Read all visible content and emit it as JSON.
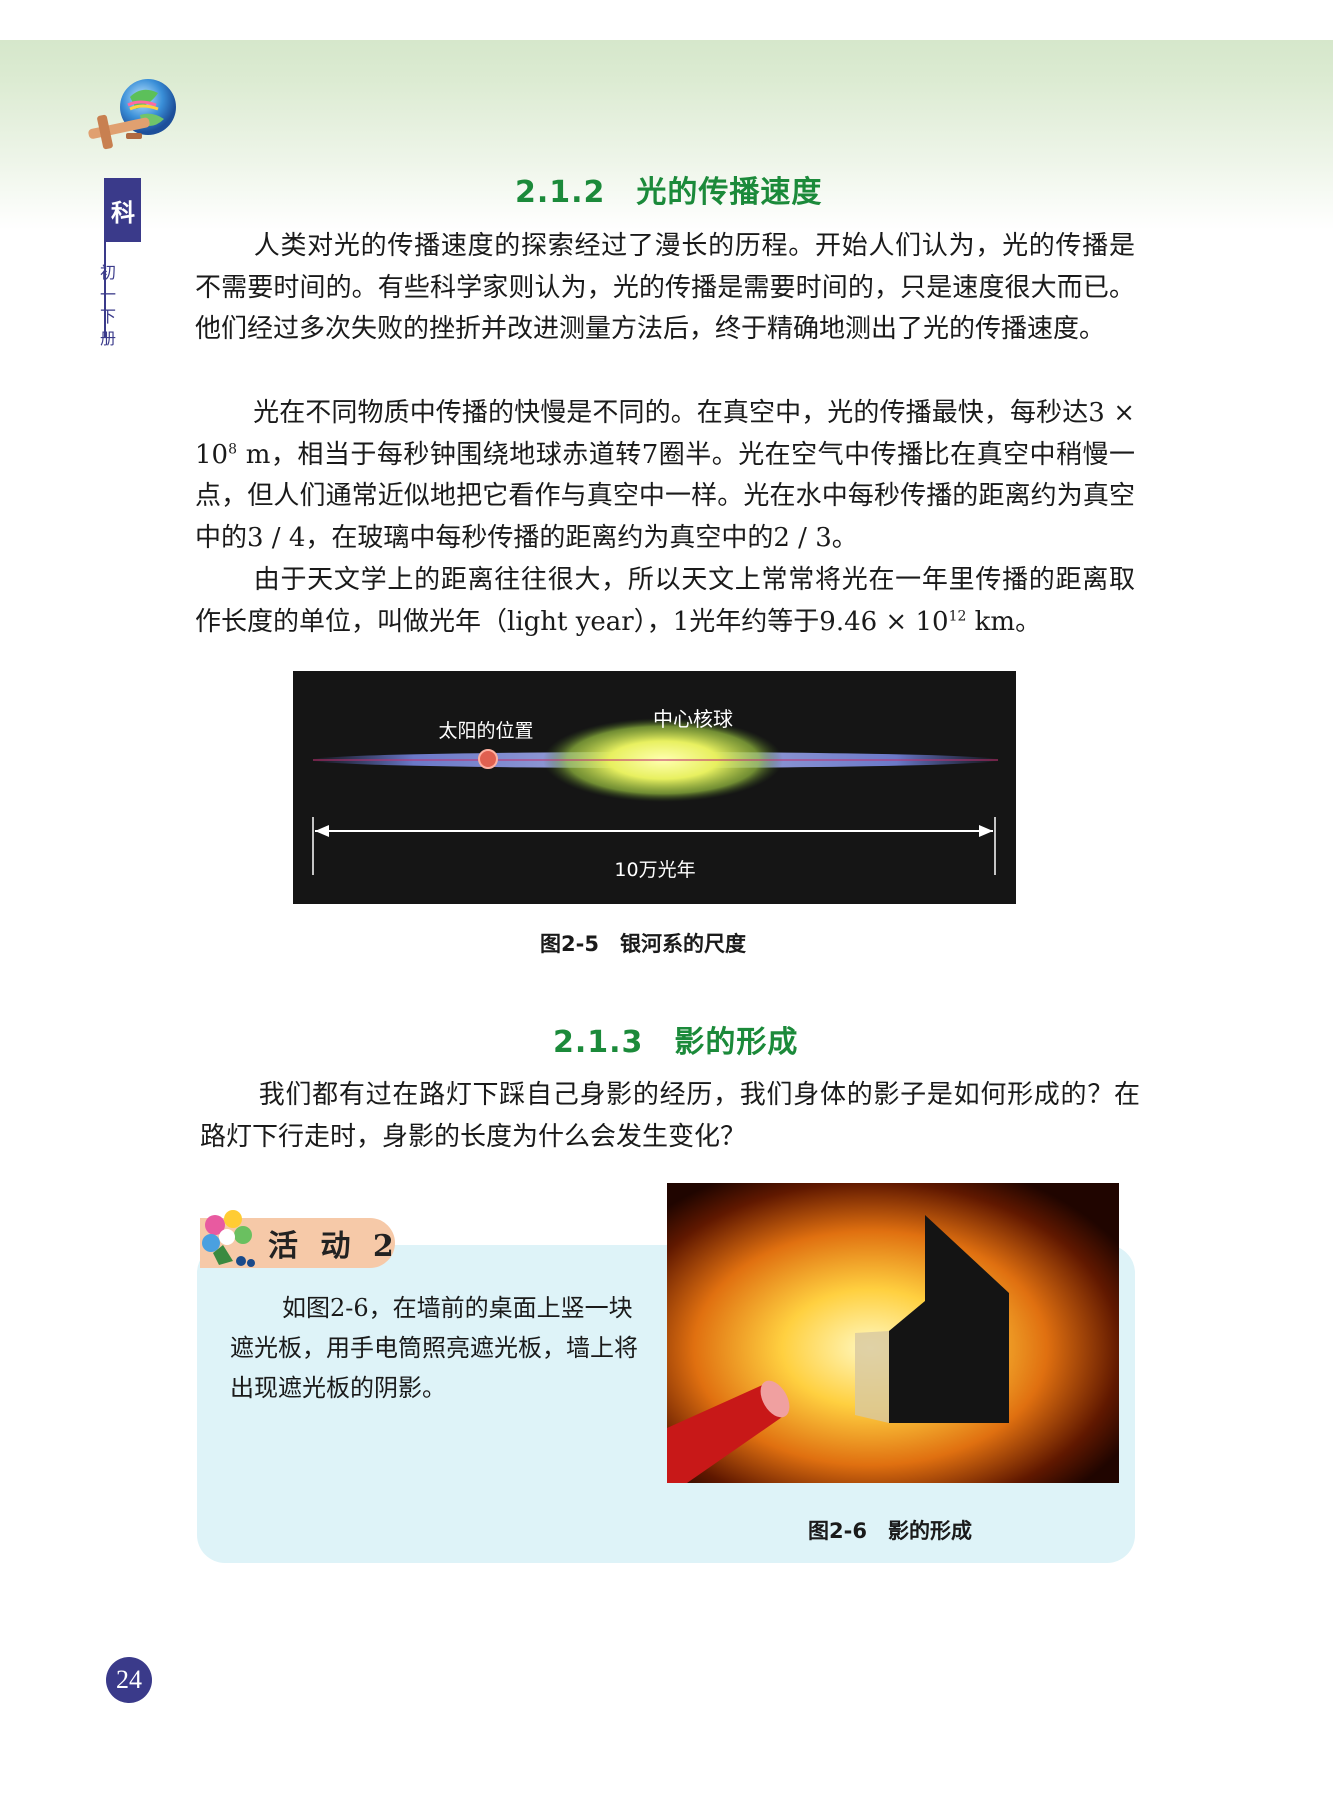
{
  "side": {
    "subject_char": "科",
    "grade_label": "初一下册"
  },
  "section1": {
    "title": "2.1.2　光的传播速度",
    "para1": "人类对光的传播速度的探索经过了漫长的历程。开始人们认为，光的传播是不需要时间的。有些科学家则认为，光的传播是需要时间的，只是速度很大而已。他们经过多次失败的挫折并改进测量方法后，终于精确地测出了光的传播速度。",
    "para2_a": "光在不同物质中传播的快慢是不同的。在真空中，光的传播最快，每秒达3 × 10",
    "para2_exp": "8",
    "para2_b": " m，相当于每秒钟围绕地球赤道转7圈半。光在空气中传播比在真空中稍慢一点，但人们通常近似地把它看作与真空中一样。光在水中每秒传播的距离约为真空中的3 / 4，在玻璃中每秒传播的距离约为真空中的2 / 3。",
    "para3_a": "由于天文学上的距离往往很大，所以天文上常常将光在一年里传播的距离取作长度的单位，叫做光年（light year），1光年约等于9.46 × 10",
    "para3_exp": "12",
    "para3_b": " km。"
  },
  "figure_galaxy": {
    "label_core": "中心核球",
    "label_sun": "太阳的位置",
    "label_scale": "10万光年",
    "caption": "图2-5　银河系的尺度"
  },
  "section2": {
    "title": "2.1.3　影的形成",
    "para1": "我们都有过在路灯下踩自己身影的经历，我们身体的影子是如何形成的？在路灯下行走时，身影的长度为什么会发生变化？"
  },
  "activity": {
    "tag": "活 动 2",
    "text": "如图2-6，在墙前的桌面上竖一块遮光板，用手电筒照亮遮光板，墙上将出现遮光板的阴影。"
  },
  "figure_shadow": {
    "caption": "图2-6　影的形成"
  },
  "page_number": "24",
  "colors": {
    "accent_green": "#1b8a3a",
    "tab_blue": "#3a3a8a",
    "activity_bg": "#def3f8",
    "activity_tag": "#f6c9a8"
  }
}
